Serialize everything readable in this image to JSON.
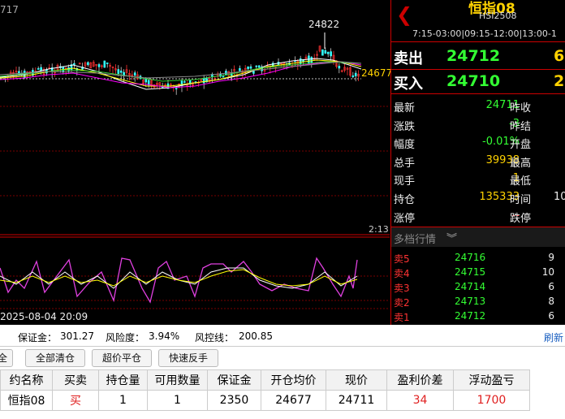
{
  "chart": {
    "top_left_label": "717",
    "high_label": "24822",
    "price_tag": "24677",
    "time_label": "2:13",
    "date_time": "2025-08-04 20:09"
  },
  "header": {
    "title": "恒指08",
    "code": "HSI2508",
    "sessions": "7:15-03:00|09:15-12:00|13:00-1"
  },
  "quote": {
    "sell_label": "卖出",
    "sell_price": "24712",
    "sell_qty": "6",
    "buy_label": "买入",
    "buy_price": "24710",
    "buy_qty": "2",
    "rows": [
      {
        "l1": "最新",
        "v1": "24711",
        "l2": "昨收",
        "v2": ""
      },
      {
        "l1": "涨跌",
        "v1": "-3",
        "l2": "昨结",
        "v2": ""
      },
      {
        "l1": "幅度",
        "v1": "-0.01%",
        "l2": "开盘",
        "v2": ""
      },
      {
        "l1": "总手",
        "v1": "39938",
        "l2": "最高",
        "v2": ""
      },
      {
        "l1": "现手",
        "v1": "1",
        "l2": "最低",
        "v2": ""
      },
      {
        "l1": "持仓",
        "v1": "135333",
        "l2": "时间",
        "v2": "10"
      },
      {
        "l1": "涨停",
        "v1": "--",
        "l2": "跌停",
        "v2": ""
      }
    ]
  },
  "depth": {
    "title": "多档行情",
    "rows": [
      {
        "label": "卖5",
        "price": "24716",
        "qty": "9"
      },
      {
        "label": "卖4",
        "price": "24715",
        "qty": "10"
      },
      {
        "label": "卖3",
        "price": "24714",
        "qty": "6"
      },
      {
        "label": "卖2",
        "price": "24713",
        "qty": "8"
      },
      {
        "label": "卖1",
        "price": "24712",
        "qty": "6"
      }
    ]
  },
  "account": {
    "margin_label": "保证金：",
    "margin": "301.27",
    "risk_label": "风险度：",
    "risk": "3.94%",
    "control_label": "风控线：",
    "control": "200.85",
    "refresh": "刷新"
  },
  "toolbar": {
    "btn0": "全",
    "btn1": "全部清仓",
    "btn2": "超价平仓",
    "btn3": "快速反手"
  },
  "positions": {
    "headers": [
      "约名称",
      "买卖",
      "持仓量",
      "可用数量",
      "保证金",
      "开仓均价",
      "现价",
      "盈利价差",
      "浮动盈亏"
    ],
    "rows": [
      [
        "恒指08",
        "买",
        "1",
        "1",
        "2350",
        "24677",
        "24711",
        "34",
        "1700"
      ]
    ]
  },
  "colors": {
    "up": "#ff3333",
    "down": "#33ff33",
    "price_yellow": "#ffd200",
    "accent_red": "#cc0000"
  }
}
